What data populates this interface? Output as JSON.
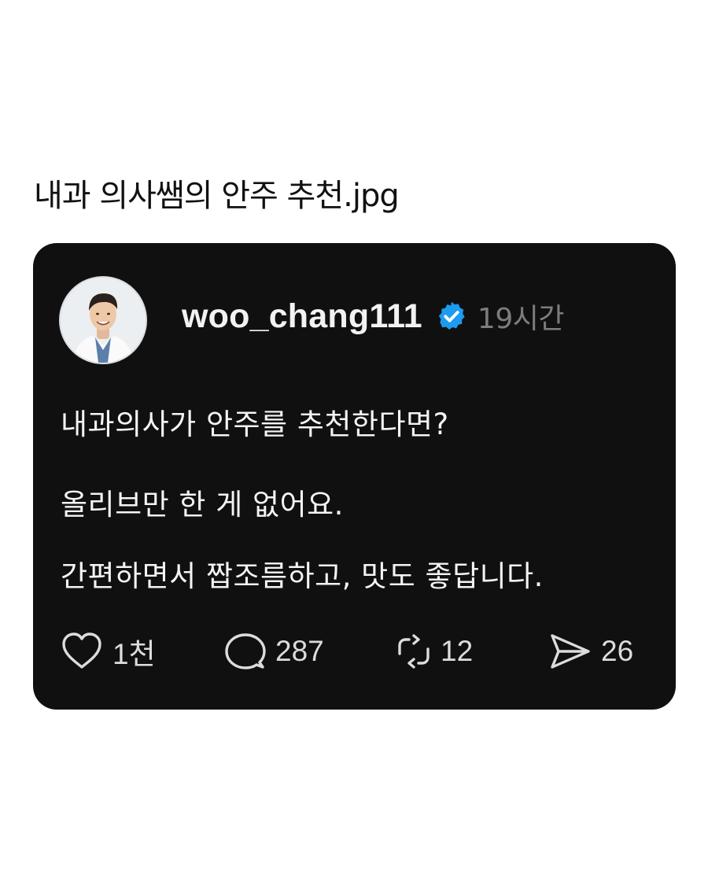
{
  "page_title": "내과 의사쌤의 안주 추천.jpg",
  "post": {
    "username": "woo_chang111",
    "verified_icon": "verified-badge-icon",
    "time_ago": "19시간",
    "lines": [
      "내과의사가 안주를 추천한다면?",
      "올리브만 한 게 없어요.",
      "간편하면서 짭조름하고, 맛도 좋답니다."
    ],
    "actions": {
      "likes": "1천",
      "comments": "287",
      "reposts": "12",
      "shares": "26"
    }
  },
  "colors": {
    "card_background": "#101010",
    "verified_blue": "#1d9bf0",
    "text_primary": "#f4f4f4",
    "text_muted": "#7d7d7d"
  }
}
